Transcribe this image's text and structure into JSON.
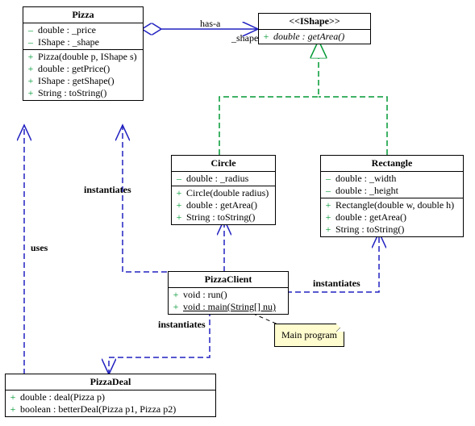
{
  "classes": {
    "pizza": {
      "name": "Pizza",
      "attrs": [
        {
          "vis": "–",
          "text": "double : _price"
        },
        {
          "vis": "–",
          "text": "IShape : _shape"
        }
      ],
      "ops": [
        {
          "vis": "+",
          "text": "Pizza(double p, IShape s)"
        },
        {
          "vis": "+",
          "text": "double : getPrice()"
        },
        {
          "vis": "+",
          "text": "IShape : getShape()"
        },
        {
          "vis": "+",
          "text": "String : toString()"
        }
      ]
    },
    "ishape": {
      "name": "<<IShape>>",
      "ops": [
        {
          "vis": "+",
          "text": "double : getArea()",
          "abstract": true
        }
      ]
    },
    "circle": {
      "name": "Circle",
      "attrs": [
        {
          "vis": "–",
          "text": "double : _radius"
        }
      ],
      "ops": [
        {
          "vis": "+",
          "text": "Circle(double radius)"
        },
        {
          "vis": "+",
          "text": "double : getArea()"
        },
        {
          "vis": "+",
          "text": "String : toString()"
        }
      ]
    },
    "rectangle": {
      "name": "Rectangle",
      "attrs": [
        {
          "vis": "–",
          "text": "double : _width"
        },
        {
          "vis": "–",
          "text": "double : _height"
        }
      ],
      "ops": [
        {
          "vis": "+",
          "text": "Rectangle(double w, double h)"
        },
        {
          "vis": "+",
          "text": "double : getArea()"
        },
        {
          "vis": "+",
          "text": "String : toString()"
        }
      ]
    },
    "pizzaclient": {
      "name": "PizzaClient",
      "ops": [
        {
          "vis": "+",
          "text": "void : run()"
        },
        {
          "vis": "+",
          "text": "void : main(String[] nu)",
          "underline": true
        }
      ]
    },
    "pizzadeal": {
      "name": "PizzaDeal",
      "ops": [
        {
          "vis": "+",
          "text": "double : deal(Pizza p)"
        },
        {
          "vis": "+",
          "text": "boolean : betterDeal(Pizza p1, Pizza p2)"
        }
      ]
    }
  },
  "labels": {
    "hasA": "has-a",
    "shape": "_shape",
    "instantiates": "instantiates",
    "uses": "uses",
    "mainProgram": "Main program"
  }
}
